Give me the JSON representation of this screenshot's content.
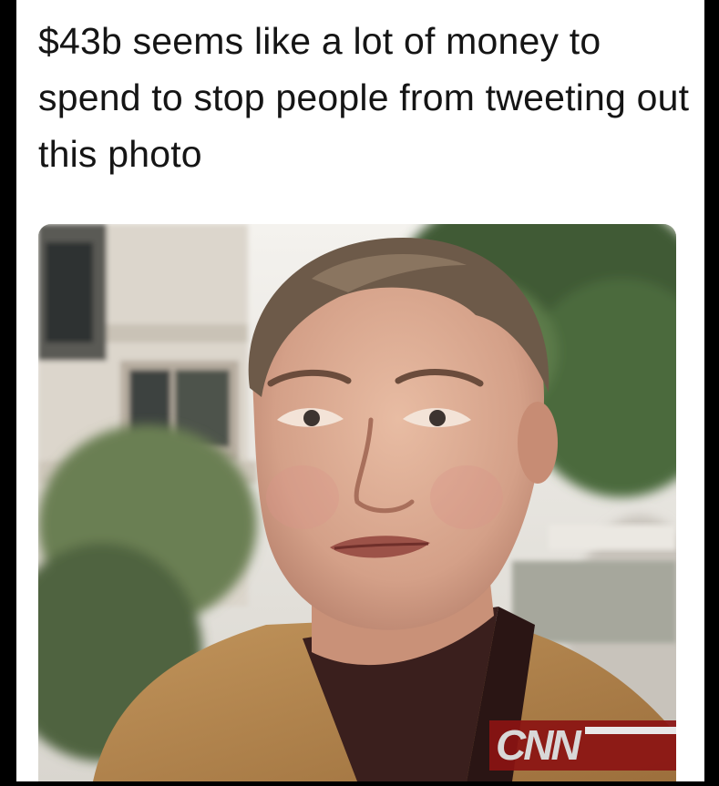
{
  "post": {
    "caption": "$43b seems like a lot of money to spend to stop people from tweeting out this photo"
  },
  "photo": {
    "network_bug": "CNN"
  },
  "colors": {
    "background": "#000000",
    "card": "#ffffff",
    "caption_text": "#151515",
    "jacket": "#b8874f"
  }
}
